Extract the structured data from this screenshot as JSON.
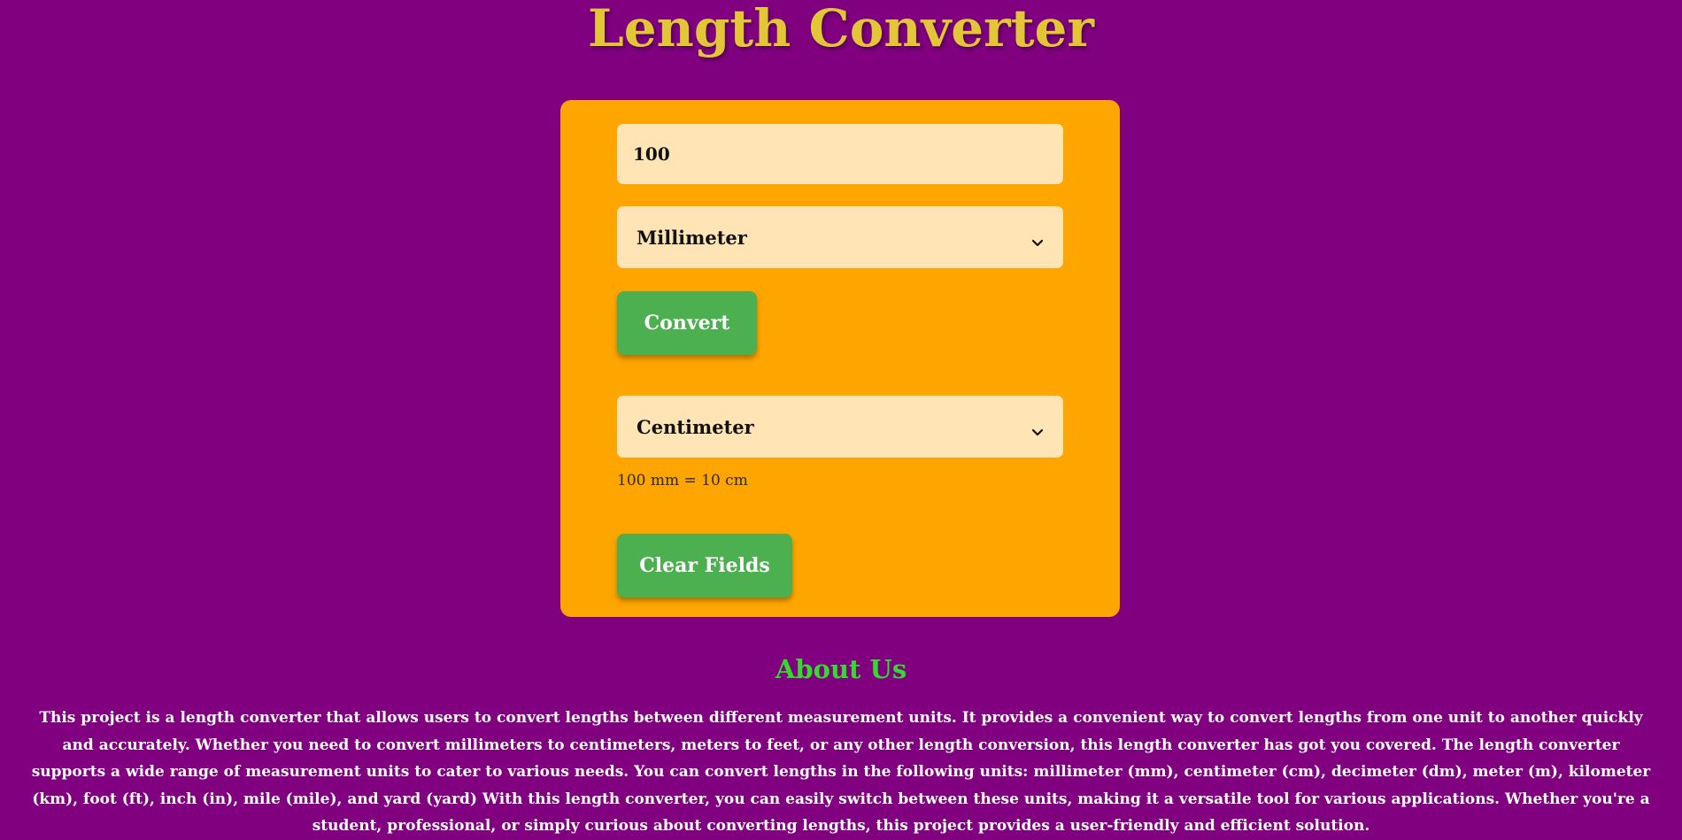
{
  "page": {
    "title": "Length Converter"
  },
  "converter": {
    "input_value": "100",
    "from_unit": "Millimeter",
    "convert_label": "Convert",
    "to_unit": "Centimeter",
    "result": "100 mm = 10 cm",
    "clear_label": "Clear Fields"
  },
  "about": {
    "heading": "About Us",
    "text": "This project is a length converter that allows users to convert lengths between different measurement units. It provides a convenient way to convert lengths from one unit to another quickly and accurately. Whether you need to convert millimeters to centimeters, meters to feet, or any other length conversion, this length converter has got you covered. The length converter supports a wide range of measurement units to cater to various needs. You can convert lengths in the following units: millimeter (mm), centimeter (cm), decimeter (dm), meter (m), kilometer (km), foot (ft), inch (in), mile (mile), and yard (yard) With this length converter, you can easily switch between these units, making it a versatile tool for various applications. Whether you're a student, professional, or simply curious about converting lengths, this project provides a user-friendly and efficient solution."
  },
  "colors": {
    "background": "#800080",
    "title": "#e3c637",
    "card": "#ffa500",
    "field": "#ffe4b5",
    "button": "#4caf50",
    "about_heading": "#35d92f"
  },
  "icons": {
    "select_arrow": "chevron-down-icon"
  }
}
